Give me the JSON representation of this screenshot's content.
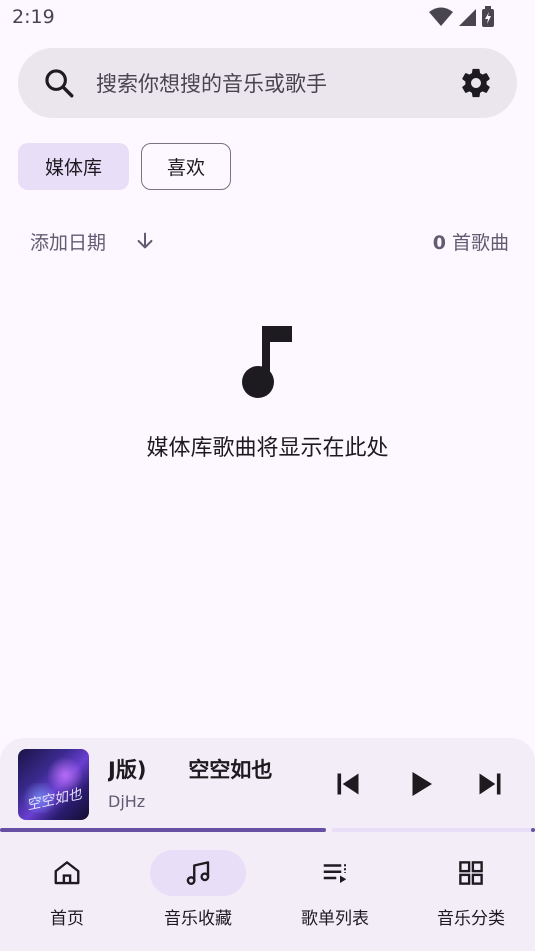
{
  "status_bar": {
    "time": "2:19"
  },
  "search": {
    "placeholder": "搜索你想搜的音乐或歌手"
  },
  "chips": [
    {
      "label": "媒体库",
      "selected": true
    },
    {
      "label": "喜欢",
      "selected": false
    }
  ],
  "sort": {
    "label": "添加日期",
    "count_number": "0",
    "count_suffix": "首歌曲"
  },
  "empty_state": {
    "message": "媒体库歌曲将显示在此处"
  },
  "player": {
    "title": "J版)　　空空如也",
    "artist": "DjHz",
    "album_art_text": "空空如也",
    "progress": 0.61
  },
  "nav": [
    {
      "label": "首页",
      "icon": "home-icon",
      "active": false
    },
    {
      "label": "音乐收藏",
      "icon": "music-note-icon",
      "active": true
    },
    {
      "label": "歌单列表",
      "icon": "queue-music-icon",
      "active": false
    },
    {
      "label": "音乐分类",
      "icon": "grid-icon",
      "active": false
    }
  ],
  "colors": {
    "background": "#fdf7ff",
    "accent": "#6750a4",
    "selected_container": "#e8def8",
    "surface_container": "#f3edf7"
  }
}
